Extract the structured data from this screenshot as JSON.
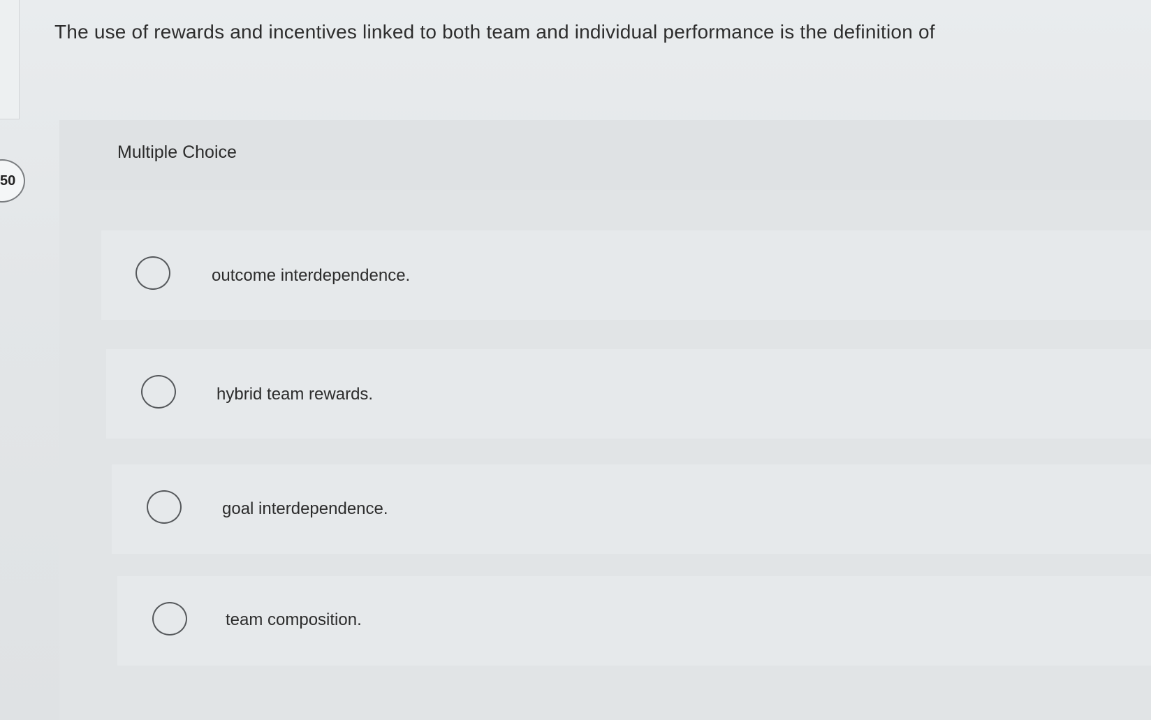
{
  "question": {
    "number": "50",
    "text": "The use of rewards and incentives linked to both team and individual performance is the definition of"
  },
  "panel": {
    "type_label": "Multiple Choice"
  },
  "options": [
    {
      "label": "outcome interdependence."
    },
    {
      "label": "hybrid team rewards."
    },
    {
      "label": "goal interdependence."
    },
    {
      "label": "team composition."
    }
  ]
}
